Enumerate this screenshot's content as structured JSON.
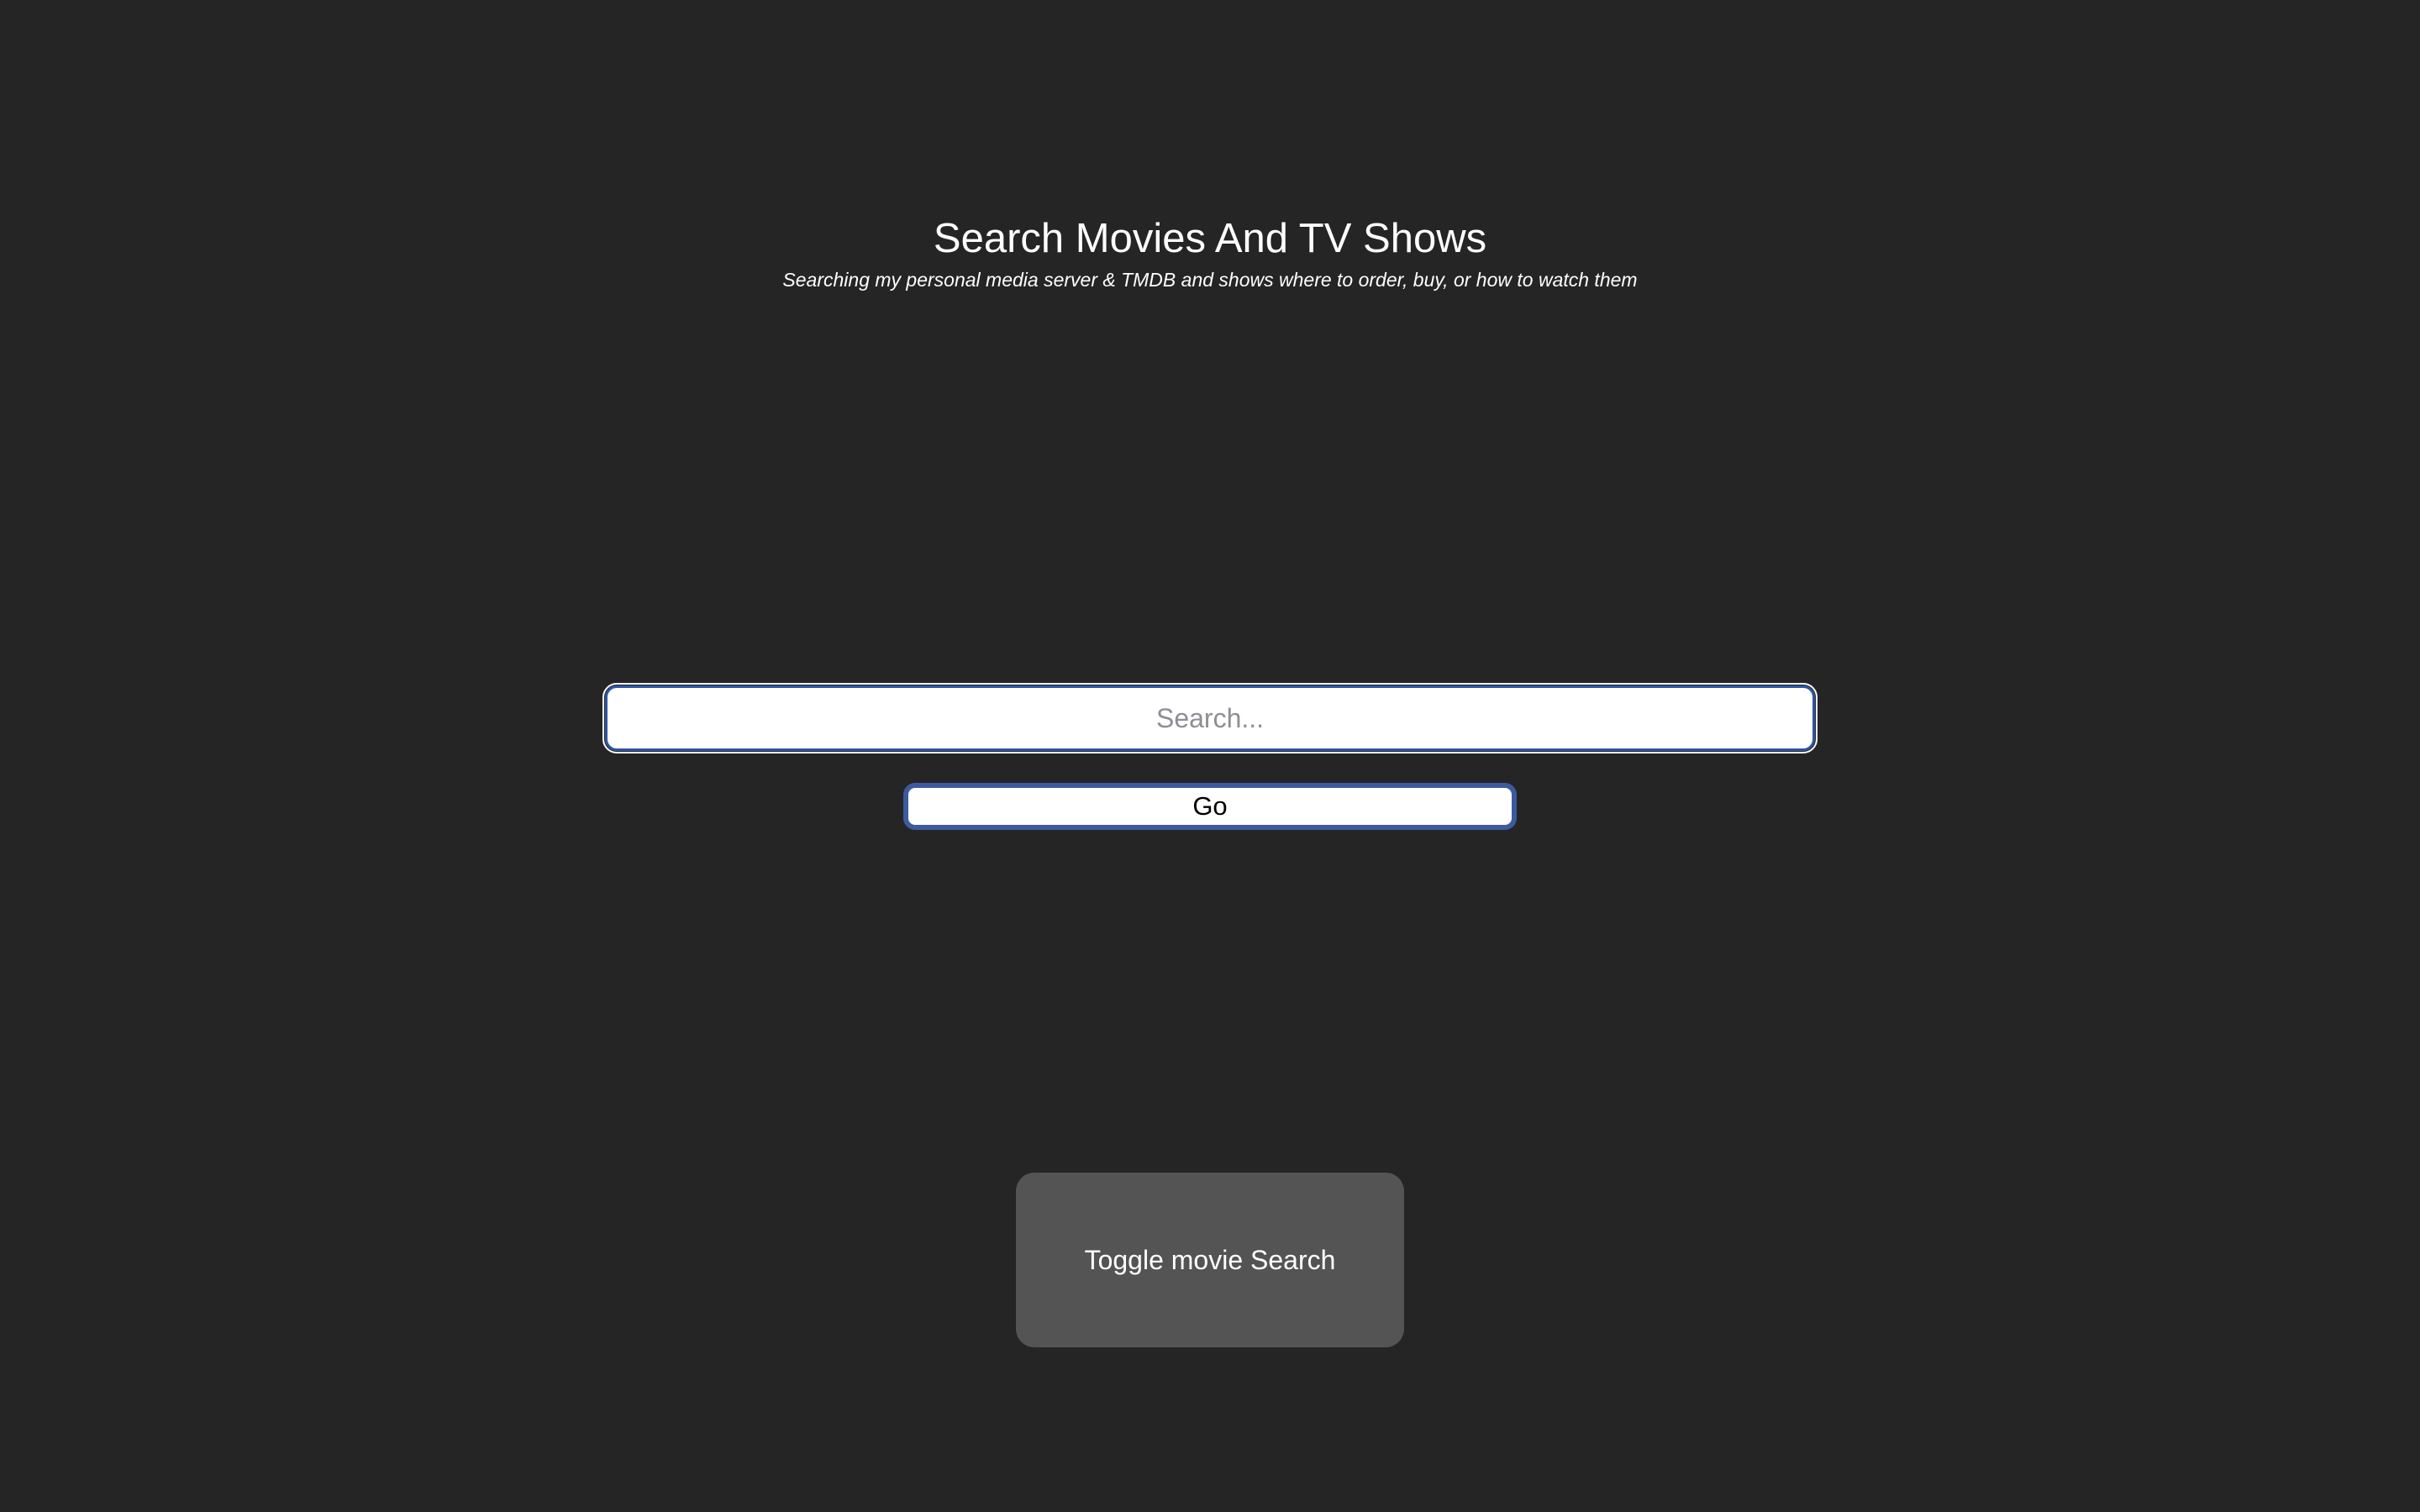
{
  "header": {
    "title": "Search Movies And TV Shows",
    "subtitle": "Searching my personal media server & TMDB and shows where to order, buy, or how to watch them"
  },
  "search": {
    "value": "",
    "placeholder": "Search..."
  },
  "go_button": {
    "label": "Go"
  },
  "toggle_button": {
    "label": "Toggle movie Search"
  },
  "colors": {
    "background": "#252525",
    "input_border": "#2d56a6",
    "button_border": "#3c5a9e",
    "toggle_background": "#545454"
  }
}
